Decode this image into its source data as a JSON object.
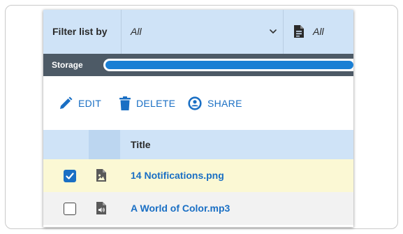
{
  "filter": {
    "label": "Filter list by",
    "selected_value": "All",
    "type_value": "All"
  },
  "storage": {
    "label": "Storage",
    "fill_fraction": 0.97
  },
  "toolbar": {
    "edit_label": "EDIT",
    "delete_label": "DELETE",
    "share_label": "SHARE"
  },
  "table": {
    "title_header": "Title",
    "rows": [
      {
        "title": "14 Notifications.png",
        "checked": true,
        "file_type": "image-file-icon"
      },
      {
        "title": "A World of Color.mp3",
        "checked": false,
        "file_type": "audio-file-icon"
      }
    ]
  },
  "colors": {
    "accent": "#1a6fc4",
    "header_bg": "#cfe3f7",
    "storage_bar": "#4d5a66",
    "selected_row": "#fbf8d4",
    "alt_row": "#f2f2f2"
  }
}
